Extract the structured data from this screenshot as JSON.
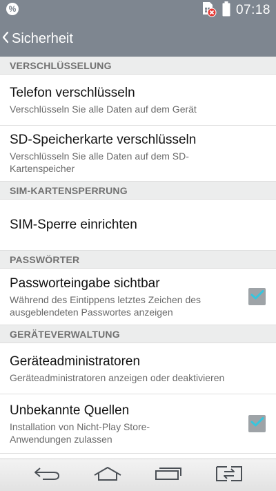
{
  "status_bar": {
    "time": "07:18",
    "icons": [
      "percent-app-icon",
      "sim-error-icon",
      "battery-icon"
    ]
  },
  "action_bar": {
    "title": "Sicherheit"
  },
  "sections": [
    {
      "header": "VERSCHLÜSSELUNG",
      "items": [
        {
          "title": "Telefon verschlüsseln",
          "subtitle": "Verschlüsseln Sie alle Daten auf dem Gerät"
        },
        {
          "title": "SD-Speicherkarte verschlüsseln",
          "subtitle_line1": "Verschlüsseln Sie alle Daten auf dem SD-",
          "subtitle_line2": "Kartenspeicher"
        }
      ]
    },
    {
      "header": "SIM-KARTENSPERRUNG",
      "items": [
        {
          "title": "SIM-Sperre einrichten"
        }
      ]
    },
    {
      "header": "PASSWÖRTER",
      "items": [
        {
          "title": "Passworteingabe sichtbar",
          "subtitle_line1": "Während des Eintippens letztes Zeichen des",
          "subtitle_line2": "ausgeblendeten Passwortes anzeigen",
          "checked": true
        }
      ]
    },
    {
      "header": "GERÄTEVERWALTUNG",
      "items": [
        {
          "title": "Geräteadministratoren",
          "subtitle": "Geräteadministratoren anzeigen oder deaktivieren"
        },
        {
          "title": "Unbekannte Quellen",
          "subtitle_line1": "Installation von Nicht-Play Store-",
          "subtitle_line2": "Anwendungen zulassen",
          "checked": true
        }
      ]
    }
  ],
  "nav_bar": {
    "buttons": [
      "back-nav-icon",
      "home-icon",
      "recent-apps-icon",
      "dual-window-icon"
    ]
  },
  "colors": {
    "bar": "#7e8690",
    "section_bg": "#eceded",
    "check_tick": "#35c6de",
    "checkbox_bg": "#9ea3a7"
  }
}
